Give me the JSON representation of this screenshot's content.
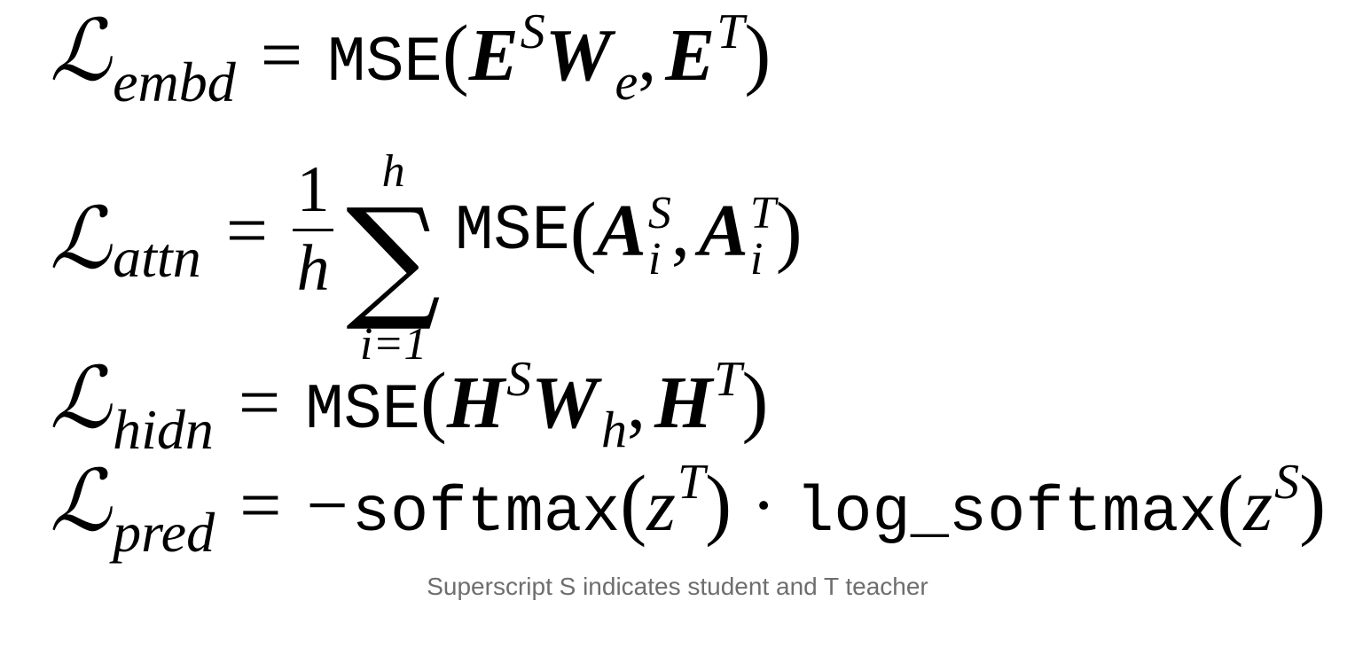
{
  "equations": {
    "embd": {
      "lhs": "ℒ",
      "sub": "embd",
      "eq": "=",
      "fn": "MSE",
      "open": "(",
      "close": ")",
      "term1": "E",
      "term1_sup": "S",
      "term2": "W",
      "term2_sub": "e",
      "comma": ",",
      "term3": "E",
      "term3_sup": "T"
    },
    "attn": {
      "lhs": "ℒ",
      "sub": "attn",
      "eq": "=",
      "frac_num": "1",
      "frac_den": "h",
      "sum_symbol": "∑",
      "sum_upper": "h",
      "sum_lower": "i=1",
      "fn": "MSE",
      "open": "(",
      "close": ")",
      "term1": "A",
      "term1_sup": "S",
      "term1_sub": "i",
      "comma": ",",
      "term2": "A",
      "term2_sup": "T",
      "term2_sub": "i"
    },
    "hidn": {
      "lhs": "ℒ",
      "sub": "hidn",
      "eq": "=",
      "fn": "MSE",
      "open": "(",
      "close": ")",
      "term1": "H",
      "term1_sup": "S",
      "term2": "W",
      "term2_sub": "h",
      "comma": ",",
      "term3": "H",
      "term3_sup": "T"
    },
    "pred": {
      "lhs": "ℒ",
      "sub": "pred",
      "eq": "=",
      "minus": "−",
      "fn1": "softmax",
      "open": "(",
      "close": ")",
      "var1": "z",
      "var1_sup": "T",
      "dot": "·",
      "fn2": "log_softmax",
      "var2": "z",
      "var2_sup": "S"
    }
  },
  "caption": "Superscript S indicates student and T teacher"
}
